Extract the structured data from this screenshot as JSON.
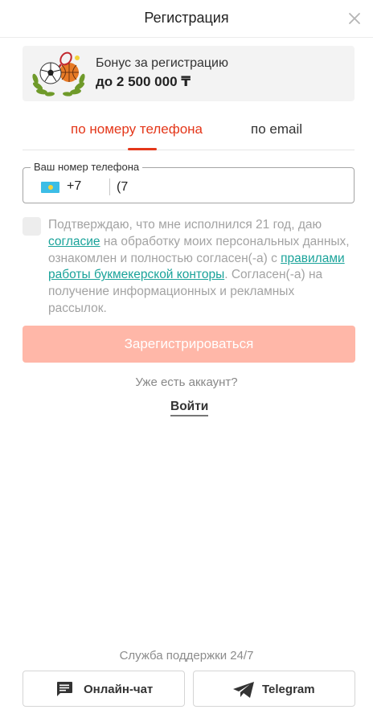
{
  "header": {
    "title": "Регистрация"
  },
  "bonus": {
    "label": "Бонус за регистрацию",
    "amount": "до 2 500 000 ₸"
  },
  "tabs": [
    {
      "label": "по номеру телефона",
      "active": true
    },
    {
      "label": "по email",
      "active": false
    }
  ],
  "phone": {
    "legend": "Ваш номер телефона",
    "country_code": "+7",
    "value": "(7",
    "flag": "kazakhstan-flag-icon"
  },
  "consent": {
    "text_1": "Подтверждаю, что мне исполнился 21 год, даю ",
    "link_1": "согласие",
    "text_2": " на обработку моих персональных данных, ознакомлен и полностью согласен(-а) с ",
    "link_2": "правилами работы букмекерской конторы",
    "text_3": ". Согласен(-а) на получение информационных и рекламных рассылок.",
    "checked": false
  },
  "register_button": "Зарегистрироваться",
  "login": {
    "question": "Уже есть аккаунт?",
    "link": "Войти"
  },
  "support": {
    "label": "Служба поддержки 24/7",
    "chat_label": "Онлайн-чат",
    "telegram_label": "Telegram"
  },
  "colors": {
    "accent": "#e4371a",
    "register_disabled": "#ffb7a8",
    "link": "#1aa39a"
  }
}
